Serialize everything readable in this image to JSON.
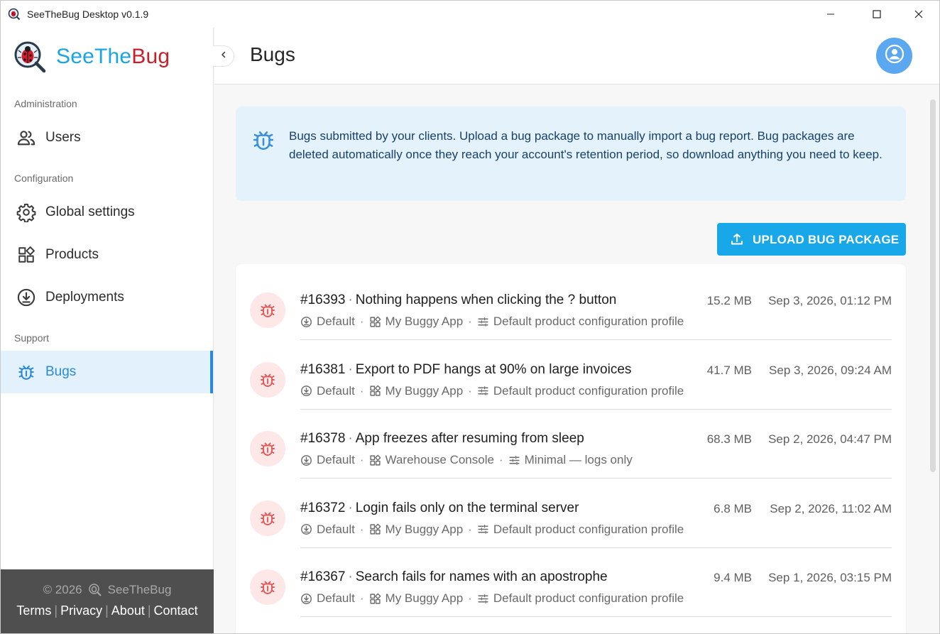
{
  "window": {
    "title": "SeeTheBug Desktop v0.1.9"
  },
  "brand": {
    "see": "See",
    "the": "The",
    "bug": "Bug"
  },
  "sidebar": {
    "sections": [
      {
        "label": "Administration"
      },
      {
        "label": "Configuration"
      },
      {
        "label": "Support"
      }
    ],
    "items": [
      {
        "label": "Users",
        "icon": "users-icon"
      },
      {
        "label": "Global settings",
        "icon": "gear-icon"
      },
      {
        "label": "Products",
        "icon": "apps-icon"
      },
      {
        "label": "Deployments",
        "icon": "download-circle-icon"
      },
      {
        "label": "Bugs",
        "icon": "bug-icon",
        "active": true
      }
    ],
    "footer": {
      "copyright": "© 2026",
      "brand": "SeeTheBug",
      "links": [
        "Terms",
        "Privacy",
        "About",
        "Contact"
      ]
    }
  },
  "header": {
    "title": "Bugs"
  },
  "info": {
    "text": "Bugs submitted by your clients. Upload a bug package to manually import a bug report. Bug packages are deleted automatically once they reach your account's retention period, so download anything you need to keep."
  },
  "upload": {
    "label": "UPLOAD BUG PACKAGE"
  },
  "bugs": [
    {
      "id": "#16393",
      "title": "Nothing happens when clicking the ? button",
      "size": "15.2 MB",
      "date": "Sep 3, 2026, 01:12 PM",
      "deployment": "Default",
      "product": "My Buggy App",
      "profile": "Default product configuration profile"
    },
    {
      "id": "#16381",
      "title": "Export to PDF hangs at 90% on large invoices",
      "size": "41.7 MB",
      "date": "Sep 3, 2026, 09:24 AM",
      "deployment": "Default",
      "product": "My Buggy App",
      "profile": "Default product configuration profile"
    },
    {
      "id": "#16378",
      "title": "App freezes after resuming from sleep",
      "size": "68.3 MB",
      "date": "Sep 2, 2026, 04:47 PM",
      "deployment": "Default",
      "product": "Warehouse Console",
      "profile": "Minimal — logs only"
    },
    {
      "id": "#16372",
      "title": "Login fails only on the terminal server",
      "size": "6.8 MB",
      "date": "Sep 2, 2026, 11:02 AM",
      "deployment": "Default",
      "product": "My Buggy App",
      "profile": "Default product configuration profile"
    },
    {
      "id": "#16367",
      "title": "Search fails for names with an apostrophe",
      "size": "9.4 MB",
      "date": "Sep 1, 2026, 03:15 PM",
      "deployment": "Default",
      "product": "My Buggy App",
      "profile": "Default product configuration profile"
    }
  ],
  "colors": {
    "accent": "#18a8ea",
    "brand_blue": "#1ba5e0",
    "brand_red": "#c8202a",
    "active_nav": "#2a8ad8",
    "info_bg": "#e4f3fb",
    "bug_icon": "#e05a5a"
  }
}
